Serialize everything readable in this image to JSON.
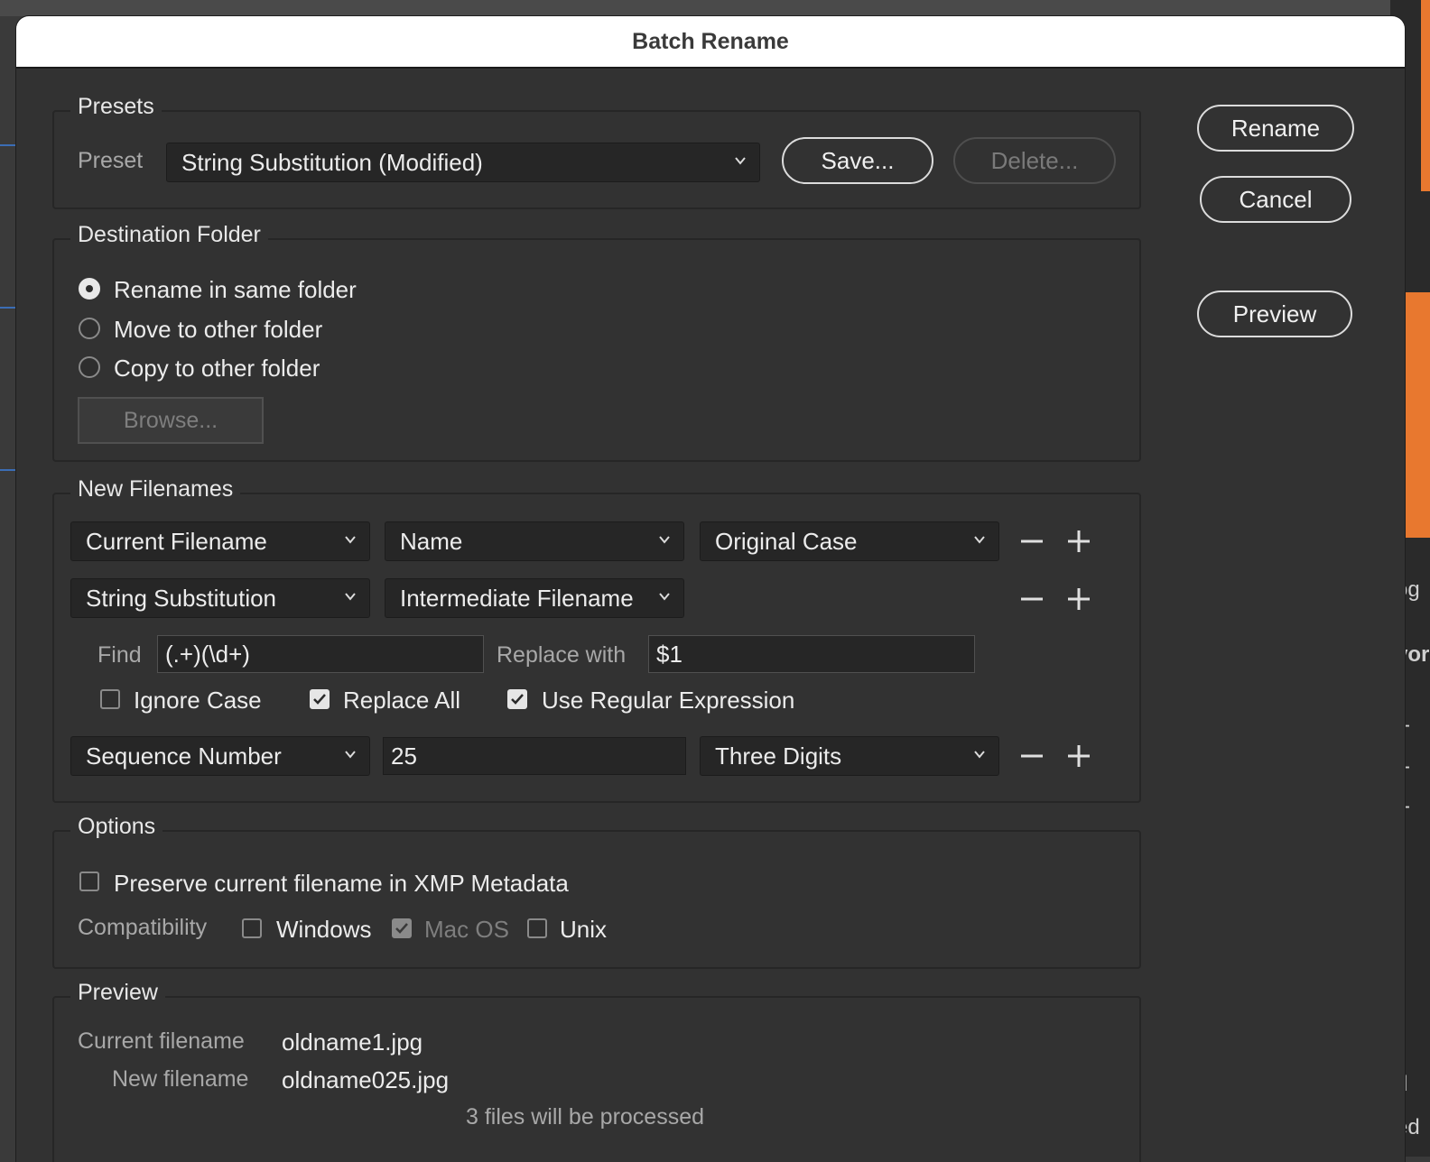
{
  "dialog": {
    "title": "Batch Rename",
    "rename_label": "Rename",
    "cancel_label": "Cancel",
    "preview_label": "Preview"
  },
  "presets": {
    "group_title": "Presets",
    "preset_label": "Preset",
    "preset_value": "String Substitution (Modified)",
    "save_label": "Save...",
    "delete_label": "Delete..."
  },
  "destination": {
    "group_title": "Destination Folder",
    "options": [
      {
        "label": "Rename in same folder",
        "selected": true
      },
      {
        "label": "Move to other folder",
        "selected": false
      },
      {
        "label": "Copy to other folder",
        "selected": false
      }
    ],
    "browse_label": "Browse..."
  },
  "new_filenames": {
    "group_title": "New Filenames",
    "row1": {
      "type": "Current Filename",
      "part": "Name",
      "case": "Original Case"
    },
    "row2": {
      "type": "String Substitution",
      "source": "Intermediate Filename"
    },
    "find_label": "Find",
    "find_value": "(.+)(\\d+)",
    "replace_label": "Replace with",
    "replace_value": "$1",
    "ignore_case_label": "Ignore Case",
    "replace_all_label": "Replace All",
    "use_regex_label": "Use Regular Expression",
    "ignore_case": false,
    "replace_all": true,
    "use_regex": true,
    "row3": {
      "type": "Sequence Number",
      "start": "25",
      "digits": "Three Digits"
    }
  },
  "options": {
    "group_title": "Options",
    "preserve_label": "Preserve current filename in XMP Metadata",
    "preserve": false,
    "compat_label": "Compatibility",
    "windows_label": "Windows",
    "macos_label": "Mac OS",
    "unix_label": "Unix",
    "windows": false,
    "macos": true,
    "unix": false
  },
  "preview": {
    "group_title": "Preview",
    "current_label": "Current filename",
    "current_value": "oldname1.jpg",
    "new_label": "New filename",
    "new_value": "oldname025.jpg",
    "summary": "3 files will be processed"
  },
  "background": {
    "fragments": [
      "og",
      "vor",
      "--",
      "--",
      "--",
      "d",
      "ed"
    ]
  },
  "colors": {
    "dialog_bg": "#323232",
    "accent_orange": "#e8782f",
    "title_bg": "#ffffff"
  }
}
